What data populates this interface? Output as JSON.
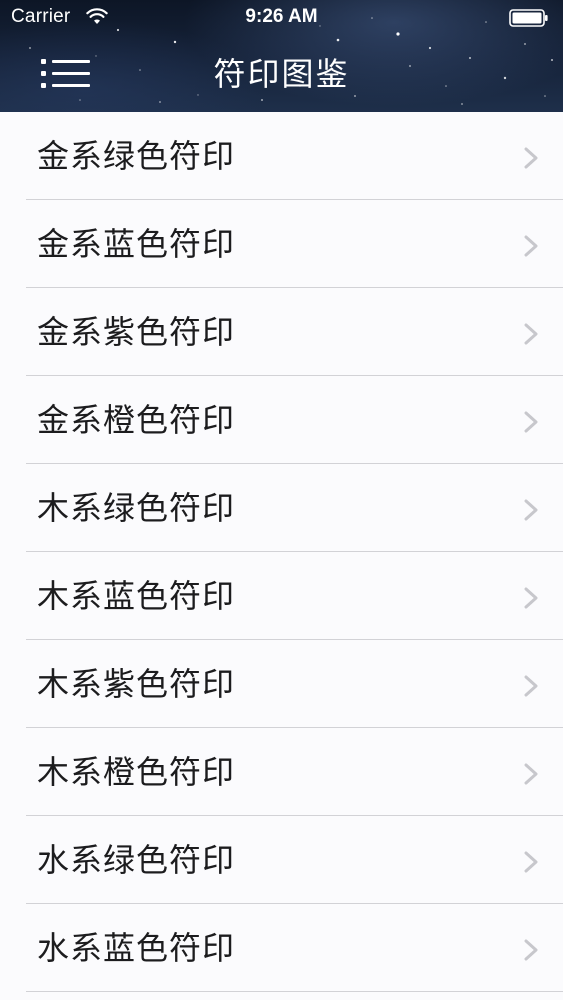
{
  "status_bar": {
    "carrier": "Carrier",
    "time": "9:26 AM"
  },
  "nav": {
    "title": "符印图鉴",
    "menu_icon": "hamburger-menu-icon"
  },
  "list": {
    "items": [
      {
        "label": "金系绿色符印"
      },
      {
        "label": "金系蓝色符印"
      },
      {
        "label": "金系紫色符印"
      },
      {
        "label": "金系橙色符印"
      },
      {
        "label": "木系绿色符印"
      },
      {
        "label": "木系蓝色符印"
      },
      {
        "label": "木系紫色符印"
      },
      {
        "label": "木系橙色符印"
      },
      {
        "label": "水系绿色符印"
      },
      {
        "label": "水系蓝色符印"
      }
    ],
    "chevron_icon": "chevron-right-icon"
  },
  "colors": {
    "chevron": "#c7c7cc",
    "separator": "#d2d2d6",
    "background": "#fbfbfd",
    "header_text": "#ffffff"
  }
}
